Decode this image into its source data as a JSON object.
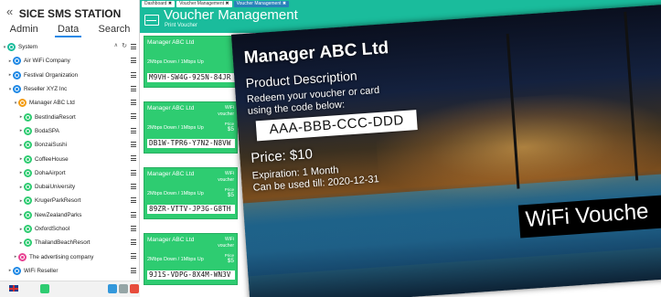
{
  "sidebar": {
    "collapse": "«",
    "brand": "SICE SMS STATION",
    "tabs": [
      {
        "label": "Admin"
      },
      {
        "label": "Data"
      },
      {
        "label": "Search"
      }
    ],
    "tree": [
      {
        "label": "System",
        "level": 0,
        "color": "teal",
        "toggle": "▾",
        "extra_controls": [
          "∧",
          "↻"
        ]
      },
      {
        "label": "Air WiFi Company",
        "level": 1,
        "color": "blue",
        "toggle": "▸"
      },
      {
        "label": "Festival Organization",
        "level": 1,
        "color": "blue",
        "toggle": "▸"
      },
      {
        "label": "Reseller XYZ Inc",
        "level": 1,
        "color": "blue",
        "toggle": "▾"
      },
      {
        "label": "Manager ABC Ltd",
        "level": 2,
        "color": "orange",
        "toggle": "▾"
      },
      {
        "label": "BestIndiaResort",
        "level": 3,
        "color": "green",
        "toggle": "▸"
      },
      {
        "label": "BodaSPA",
        "level": 3,
        "color": "green",
        "toggle": "▸"
      },
      {
        "label": "BonzaiSushi",
        "level": 3,
        "color": "green",
        "toggle": "▸"
      },
      {
        "label": "CoffeeHouse",
        "level": 3,
        "color": "green",
        "toggle": "▸"
      },
      {
        "label": "DohaAirport",
        "level": 3,
        "color": "green",
        "toggle": "▸"
      },
      {
        "label": "DubaiUniversity",
        "level": 3,
        "color": "green",
        "toggle": "▸"
      },
      {
        "label": "KrugerParkResort",
        "level": 3,
        "color": "green",
        "toggle": "▸"
      },
      {
        "label": "NewZealandParks",
        "level": 3,
        "color": "green",
        "toggle": "▸"
      },
      {
        "label": "OxfordSchool",
        "level": 3,
        "color": "green",
        "toggle": "▸"
      },
      {
        "label": "ThailandBeachResort",
        "level": 3,
        "color": "green",
        "toggle": "▸"
      },
      {
        "label": "The advertising company",
        "level": 2,
        "color": "pink",
        "toggle": "▸"
      },
      {
        "label": "WiFi Reseller",
        "level": 1,
        "color": "blue",
        "toggle": "▸"
      }
    ]
  },
  "header": {
    "breadcrumbs": [
      {
        "label": "Dashboard",
        "active": false
      },
      {
        "label": "Voucher Management",
        "active": false
      },
      {
        "label": "Voucher Management",
        "active": true
      }
    ],
    "close_glyph": "✖",
    "title": "Voucher Management",
    "subtitle": "Print Voucher"
  },
  "vouchers": [
    {
      "company": "Manager ABC Ltd",
      "wifi_line1": "",
      "wifi_line2": "",
      "speed": "2Mbps Down / 1Mbps Up",
      "price_label": "",
      "price": "",
      "code": "M9VH-SW4G-925N-84JR"
    },
    {
      "company": "Manager ABC Ltd",
      "wifi_line1": "WiFi",
      "wifi_line2": "voucher",
      "speed": "2Mbps Down / 1Mbps Up",
      "price_label": "Price",
      "price": "$5",
      "code": "DB1W-TPR6-Y7N2-N8VW"
    },
    {
      "company": "Manager ABC Ltd",
      "wifi_line1": "WiFi",
      "wifi_line2": "voucher",
      "speed": "2Mbps Down / 1Mbps Up",
      "price_label": "Price",
      "price": "$5",
      "code": "89ZR-VTTV-JP3G-G8TH"
    },
    {
      "company": "Manager ABC Ltd",
      "wifi_line1": "WiFi",
      "wifi_line2": "voucher",
      "speed": "2Mbps Down / 1Mbps Up",
      "price_label": "Price",
      "price": "$5",
      "code": "9J1S-VDPG-8X4M-WN3V"
    }
  ],
  "preview": {
    "company": "Manager ABC Ltd",
    "description": "Product Description",
    "redeem_line1": "Redeem your voucher or card",
    "redeem_line2": "using the code below:",
    "code": "AAA-BBB-CCC-DDD",
    "price": "Price: $10",
    "expiration": "Expiration: 1 Month",
    "valid_till": "Can be used till: 2020-12-31",
    "banner": "WiFi Vouche"
  },
  "colors": {
    "brand_green": "#1abc9c",
    "voucher_green": "#2ecc71",
    "active_tab": "#2980b9"
  }
}
